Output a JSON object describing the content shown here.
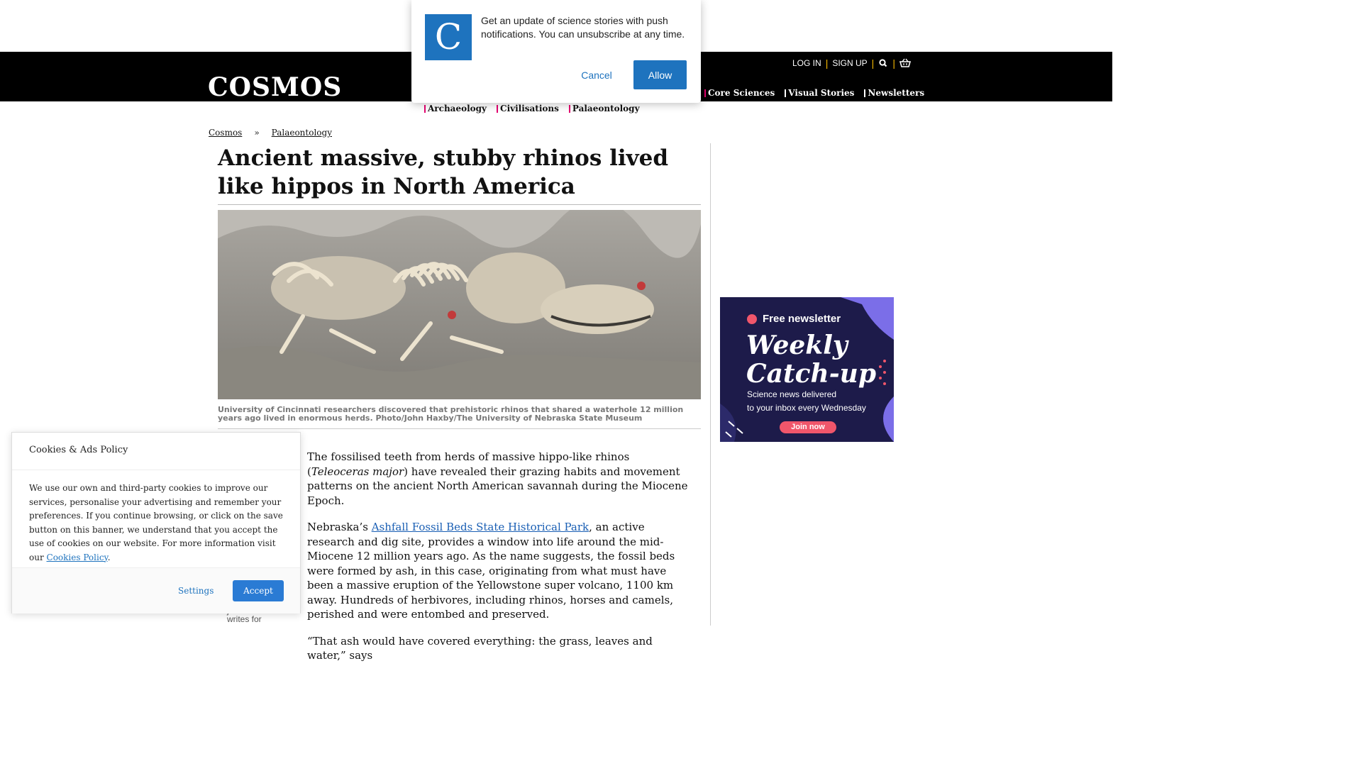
{
  "brand": {
    "logo": "COSMOS",
    "accent": "#e4006f",
    "gold": "#f5b800"
  },
  "account": {
    "login": "LOG IN",
    "signup": "SIGN UP",
    "search_icon": "search-icon",
    "basket_icon": "basket-icon"
  },
  "main_nav": [
    {
      "label": "Core Sciences"
    },
    {
      "label": "Visual Stories"
    },
    {
      "label": "Newsletters"
    }
  ],
  "sub_nav": [
    {
      "label": "Archaeology"
    },
    {
      "label": "Civilisations"
    },
    {
      "label": "Palaeontology"
    }
  ],
  "breadcrumb": {
    "home": "Cosmos",
    "separator": "»",
    "section": "Palaeontology"
  },
  "article": {
    "title": "Ancient massive, stubby rhinos lived like hippos in North America",
    "caption": "University of Cincinnati researchers discovered that prehistoric rhinos that shared a waterhole 12 million years ago lived in enormous herds. Photo/John Haxby/The University of Nebraska State Museum",
    "p1_a": "The fossilised teeth from herds of massive hippo-like rhinos (",
    "p1_species": "Teleoceras major",
    "p1_b": ") have revealed their grazing habits and movement patterns on the ancient North American savannah during the Miocene Epoch.",
    "p2_a": "Nebraska’s ",
    "p2_link": "Ashfall Fossil Beds State Historical Park",
    "p2_b": ", an active research and dig site, provides a window into life around the mid-Miocene 12 million years ago. As the name suggests, the fossil beds were formed by ash, in this case, originating from what must have been a massive eruption of the Yellowstone super volcano, 1100 km away. Hundreds of herbivores, including rhinos, horses and camels, perished and were entombed and preserved.",
    "p3": "“That ash would have covered everything: the grass, leaves and water,” says"
  },
  "author_fragment": "journalist. He writes for",
  "ad": {
    "badge": "Free newsletter",
    "title_line1": "Weekly",
    "title_line2": "Catch-up",
    "line1": "Science news delivered",
    "line2": "to your inbox every Wednesday",
    "cta": "Join now"
  },
  "push": {
    "logo_letter": "C",
    "message": "Get an update of science stories with push notifications. You can unsubscribe at any time.",
    "cancel": "Cancel",
    "allow": "Allow"
  },
  "cookies": {
    "title": "Cookies & Ads Policy",
    "body": "We use our own and third-party cookies to improve our services, personalise your advertising and remember your preferences. If you continue browsing, or click on the save button on this banner, we understand that you accept the use of cookies on our website. For more information visit our ",
    "link": "Cookies Policy",
    "body_end": ".",
    "settings": "Settings",
    "accept": "Accept"
  }
}
